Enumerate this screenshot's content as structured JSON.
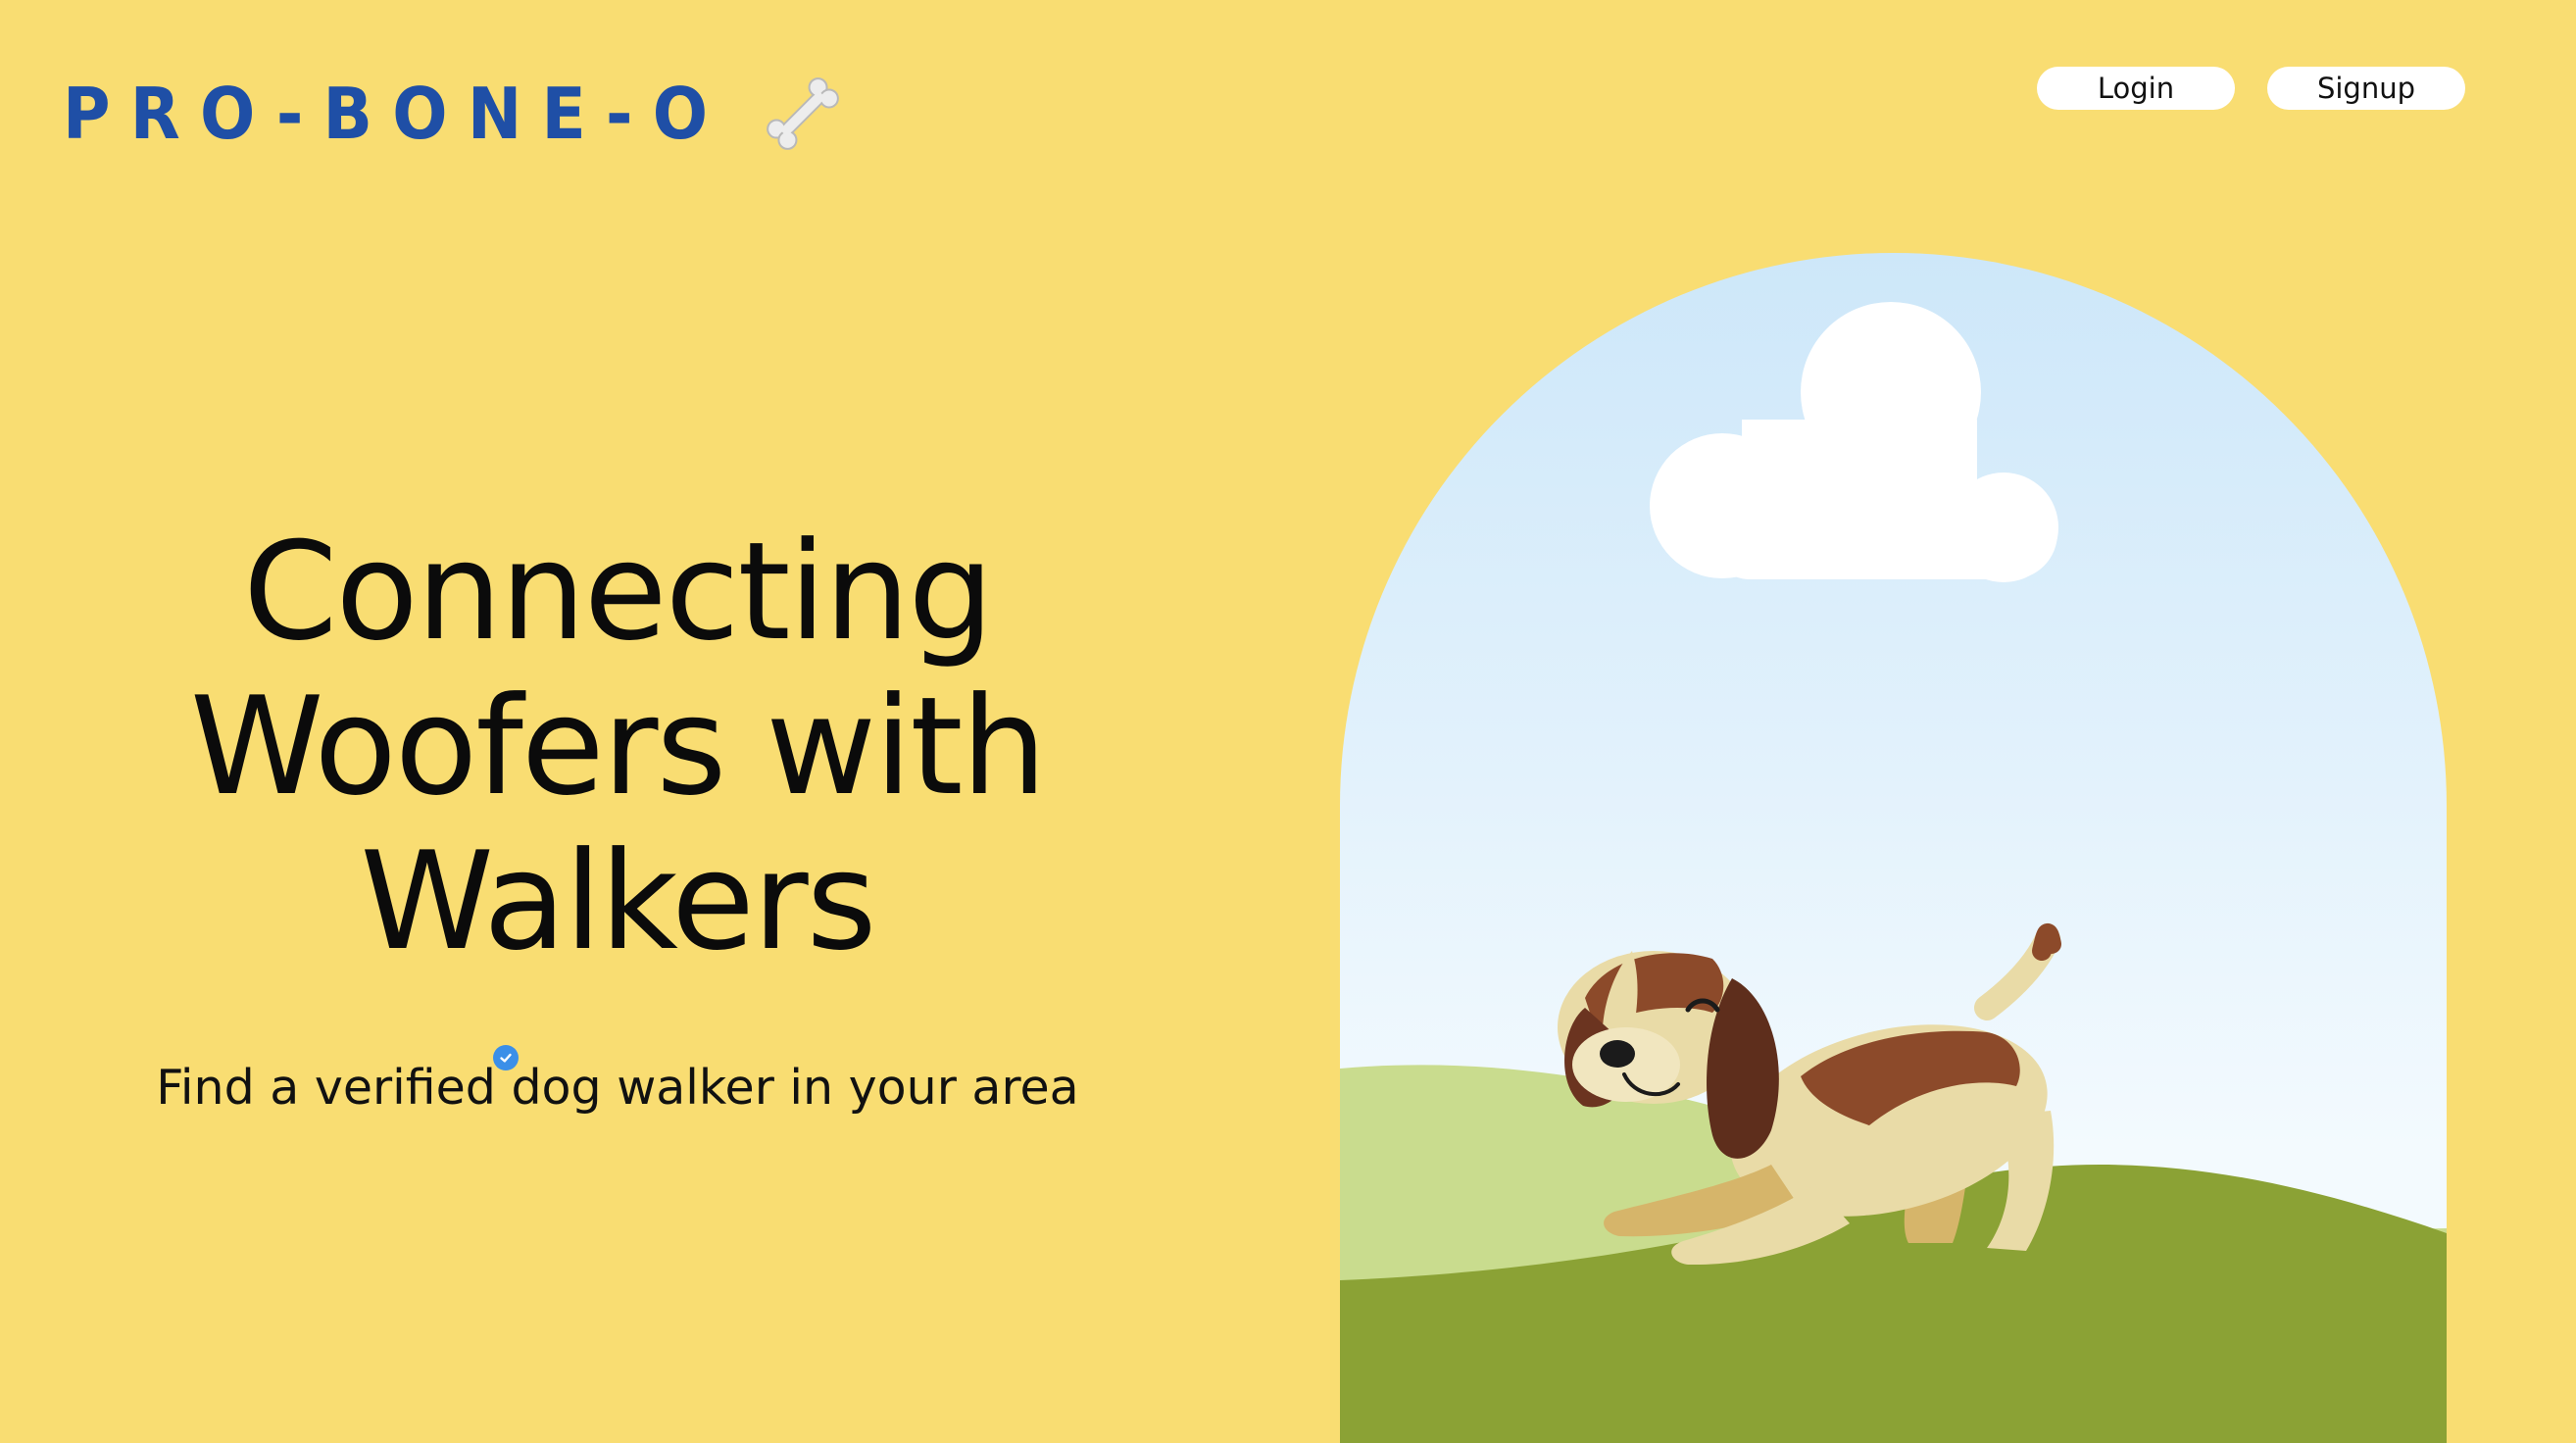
{
  "header": {
    "logo_text": "PRO-BONE-O",
    "logo_icon": "bone-icon",
    "login_label": "Login",
    "signup_label": "Signup"
  },
  "hero": {
    "headline_line1": "Connecting",
    "headline_line2": "Woofers with",
    "headline_line3": "Walkers",
    "subtitle": "Find a verified dog walker in your area",
    "verified_icon": "verified-check-icon"
  },
  "illustration": {
    "icons": [
      "cloud-icon",
      "dog-icon",
      "hills"
    ]
  },
  "colors": {
    "background": "#F9DD72",
    "logo": "#1F4FA6",
    "button_bg": "#FFFFFF",
    "headline": "#0B0B0B",
    "sky": "#D6ECFB",
    "grass_light": "#C9DC8E",
    "grass_dark": "#8BA235",
    "badge": "#3B8FE8"
  }
}
